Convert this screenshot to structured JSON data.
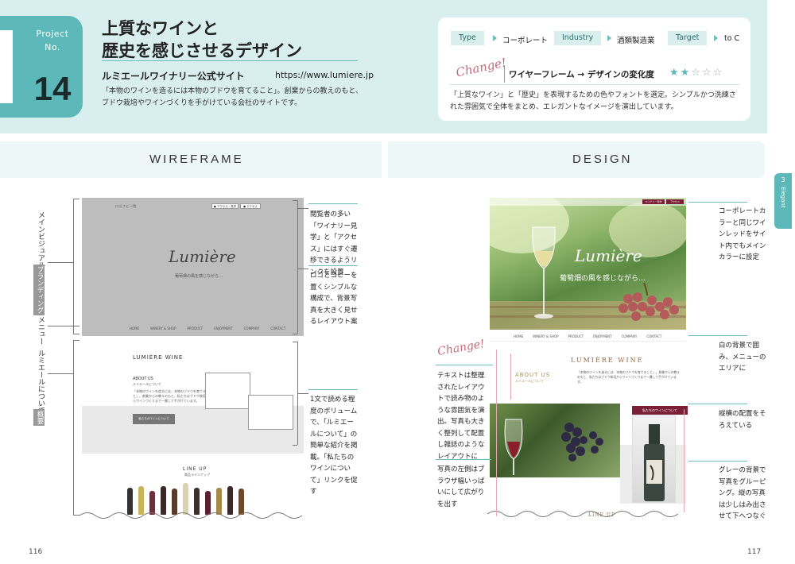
{
  "project": {
    "label_line1": "Project",
    "label_line2": "No.",
    "number": "14",
    "title_line1": "上質なワインと",
    "title_line2": "歴史を感じさせるデザイン",
    "site_name": "ルミエールワイナリー公式サイト",
    "site_url": "https://www.lumiere.jp",
    "description": "「本物のワインを造るには本物のブドウを育てること」。創業からの教えのもと、ブドウ栽培やワインづくりを手がけている会社のサイトです。"
  },
  "info": {
    "tags": [
      {
        "label": "Type",
        "value": "コーポレート"
      },
      {
        "label": "Industry",
        "value": "酒類製造業"
      },
      {
        "label": "Target",
        "value": "to C"
      }
    ],
    "change_label": "Change!",
    "change_text": "ワイヤーフレーム → デザインの変化度",
    "stars_on": "★★",
    "stars_off": "☆☆☆",
    "description": "「上質なワイン」と「歴史」を表現するための色やフォントを選定。シンプルかつ洗練された雰囲気で全体をまとめ、エレガントなイメージを演出しています。"
  },
  "sections": {
    "wireframe": "WIREFRAME",
    "design": "DESIGN"
  },
  "chapter_tab": {
    "number": "3",
    "label": "Elegant"
  },
  "wireframe": {
    "hero_logo": "Lumière",
    "hero_copy": "葡萄畑の風を感じながら…",
    "header_left": "ロゴ  ナビ  一覧",
    "header_btn1": "● アクセス・見学",
    "header_btn2": "● アクセス",
    "menu": [
      "HOME",
      "WINERY & SHOP",
      "PRODUCT",
      "ENJOYMENT",
      "COMPANY",
      "CONTACT"
    ],
    "section_title": "LUMIÈRE WINE",
    "about_title": "ABOUT US",
    "about_sub": "ルミエールについて",
    "about_text": "「本物のワインを造るには、本物のブドウを育てること」。創業からの教えのもと、私たちはブドウ栽培からワインづくりまで一貫して手がけています。",
    "about_btn": "私たちのワインについて",
    "lineup_title": "LINE UP",
    "lineup_sub": "商品ラインナップ",
    "side_labels": {
      "main_visual": "メインビジュアル",
      "branding": "ブランディング",
      "menu": "メニュー",
      "about": "ルミエールについて",
      "overview": "概要"
    },
    "notes": [
      "閲覧者の多い「ワイナリー見学」と「アクセス」にはすぐ遷移できるようリンクを設置",
      "ロゴとコピーを置くシンプルな構成で、背景写真を大きく見せるレイアウト案",
      "1文で読める程度のボリュームで、「ルミエールについて」の簡単な紹介を掲載。「私たちのワインについて」リンクを促す"
    ]
  },
  "design": {
    "hero_logo": "Lumière",
    "hero_copy": "葡萄畑の風を感じながら…",
    "nav_btn1": "ワイナリー見学",
    "nav_btn2": "アクセス",
    "menu": [
      "HOME",
      "WINERY & SHOP",
      "PRODUCT",
      "ENJOYMENT",
      "COMPANY",
      "CONTACT"
    ],
    "section_title": "LUMIÈRE WINE",
    "about_title": "ABOUT US",
    "about_sub": "ルミエールについて",
    "about_text": "「本物のワインを造るには、本物のブドウを育てること」。創業からの教えのもと、私たちはブドウ栽培からワインづくりまで一貫して手がけています。",
    "btn": "私たちのワインについて",
    "lineup": "LINE UP",
    "change_label": "Change!",
    "notes_left": [
      "テキストは整理されたレイアウトで読み物のような雰囲気を演出。写真も大きく整列して配置し雑誌のようなレイアウトに",
      "写真の左側はブラウザ幅いっぱいにして広がりを出す"
    ],
    "notes_right": [
      "コーポレートカラーと同じワインレッドをサイト内でもメインカラーに設定",
      "白の背景で囲み、メニューのエリアに",
      "縦横の配置をそろえている",
      "グレーの背景で写真をグルーピング。縦の写真は少しはみ出させて下へつなぐ"
    ]
  },
  "page_numbers": {
    "left": "116",
    "right": "117"
  },
  "colors": {
    "teal": "#5db9b9",
    "header_band": "#d9efee",
    "wine_red": "#7a1f35"
  }
}
